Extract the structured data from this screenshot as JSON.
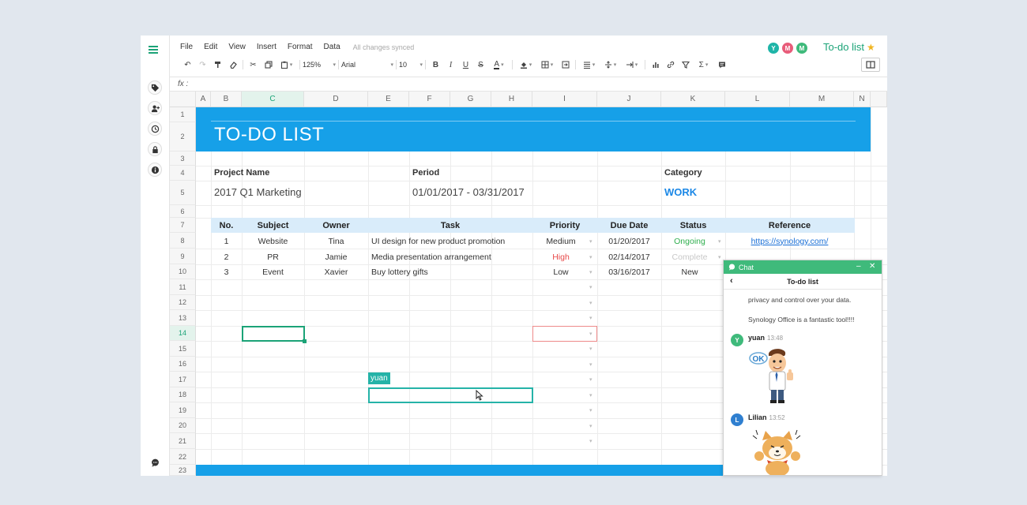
{
  "menu": [
    "File",
    "Edit",
    "View",
    "Insert",
    "Format",
    "Data"
  ],
  "sync_status": "All changes synced",
  "doc_title": "To-do list",
  "collaborators": [
    {
      "initial": "Y",
      "color": "#1fb5a8"
    },
    {
      "initial": "M",
      "color": "#e85c7a"
    },
    {
      "initial": "M",
      "color": "#3fba7b"
    }
  ],
  "toolbar": {
    "zoom": "125%",
    "font": "Arial",
    "font_size": "10"
  },
  "formula_label": "fx :",
  "columns": [
    "A",
    "B",
    "C",
    "D",
    "E",
    "F",
    "G",
    "H",
    "I",
    "J",
    "K",
    "L",
    "M",
    "N"
  ],
  "rows": [
    "1",
    "2",
    "3",
    "4",
    "5",
    "6",
    "7",
    "8",
    "9",
    "10",
    "11",
    "12",
    "13",
    "14",
    "15",
    "16",
    "17",
    "18",
    "19",
    "20",
    "21",
    "22",
    "23"
  ],
  "sheet": {
    "title": "TO-DO LIST",
    "project_label": "Project Name",
    "project_value": "2017 Q1 Marketing",
    "period_label": "Period",
    "period_value": "01/01/2017 - 03/31/2017",
    "category_label": "Category",
    "category_value": "WORK",
    "headers": [
      "No.",
      "Subject",
      "Owner",
      "Task",
      "Priority",
      "Due Date",
      "Status",
      "Reference"
    ],
    "tasks": [
      {
        "no": "1",
        "subject": "Website",
        "owner": "Tina",
        "task": "UI design for new product promotion",
        "priority": "Medium",
        "due": "01/20/2017",
        "status": "Ongoing",
        "reference": "https://synology.com/"
      },
      {
        "no": "2",
        "subject": "PR",
        "owner": "Jamie",
        "task": "Media presentation arrangement",
        "priority": "High",
        "due": "02/14/2017",
        "status": "Complete",
        "reference": ""
      },
      {
        "no": "3",
        "subject": "Event",
        "owner": "Xavier",
        "task": "Buy lottery gifts",
        "priority": "Low",
        "due": "03/16/2017",
        "status": "New",
        "reference": ""
      }
    ],
    "cursor_tag": "yuan"
  },
  "chat": {
    "header": "Chat",
    "room": "To-do list",
    "messages": [
      "privacy and control over your data.",
      "Synology Office is a fantastic tool!!!!"
    ],
    "users": [
      {
        "initial": "Y",
        "name": "yuan",
        "time": "13:48",
        "color": "#3fba7b",
        "sticker_text": "OK"
      },
      {
        "initial": "L",
        "name": "Lilian",
        "time": "13:52",
        "color": "#2f7fd0"
      }
    ]
  }
}
